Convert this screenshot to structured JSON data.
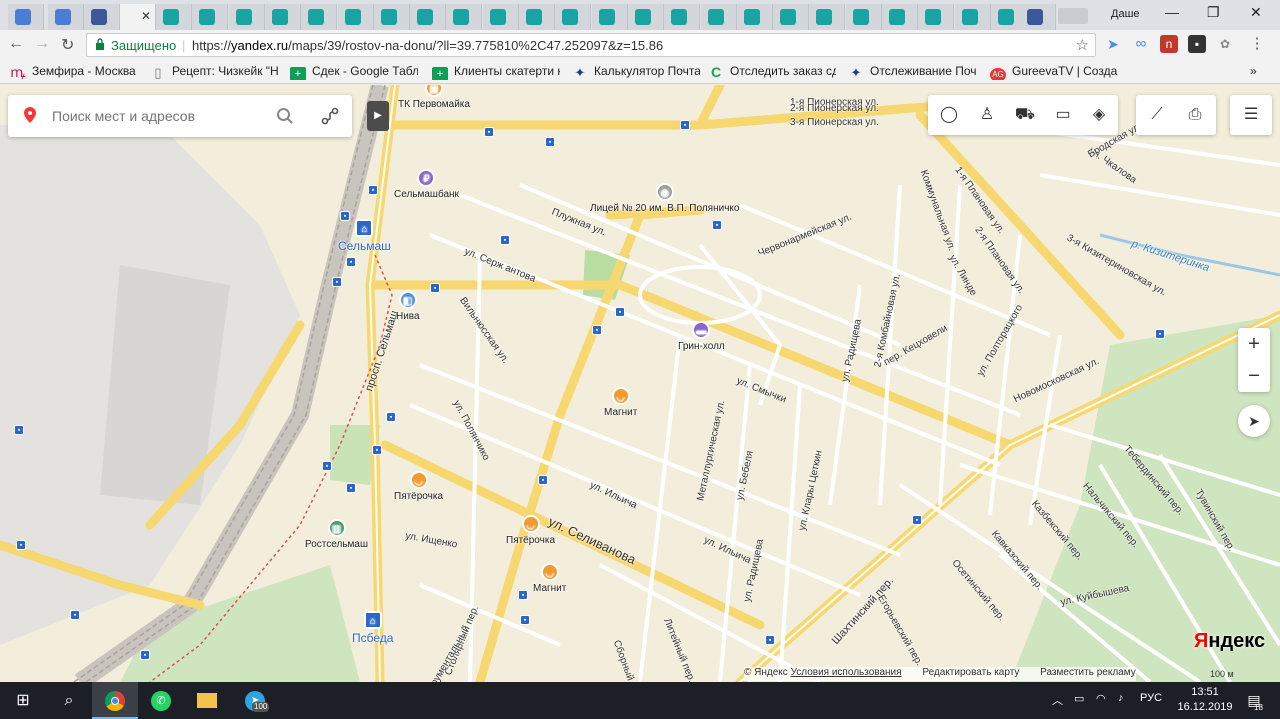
{
  "browser": {
    "profile_name": "Даше",
    "window_controls": {
      "minimize": "—",
      "maximize": "❐",
      "close": "✕"
    },
    "tabs_active_close": "✕",
    "secure_label": "Защищено",
    "url_scheme": "https://",
    "url_host": "yandex.ru",
    "url_path": "/maps/39/rostov-na-donu/?ll=39.775810%2C47.252097&z=15.86"
  },
  "bookmarks": [
    {
      "label": "Земфира - Москва",
      "icon": "music-icon",
      "color": "#c2185b"
    },
    {
      "label": "Рецепт: Чизкейк \"Н",
      "icon": "page-icon",
      "color": "#777777"
    },
    {
      "label": "Сдек - Google Табл",
      "icon": "sheets-icon",
      "color": "#0f9d58"
    },
    {
      "label": "Клиенты скатерти н",
      "icon": "sheets-icon",
      "color": "#0f9d58"
    },
    {
      "label": "Калькулятор Почта",
      "icon": "russian-post-icon",
      "color": "#1a3d8f"
    },
    {
      "label": "Отследить заказ сд",
      "icon": "cdek-icon",
      "color": "#1aa34a"
    },
    {
      "label": "Отслеживание  Поч",
      "icon": "russian-post-icon",
      "color": "#1a3d8f"
    },
    {
      "label": "GureevaTV | Создай",
      "icon": "gureeva-icon",
      "color": "#e53935"
    }
  ],
  "bookmarks_overflow": "»",
  "search": {
    "placeholder": "Поиск мест и адресов"
  },
  "map_tools": [
    "traffic-icon",
    "panorama-icon",
    "carsharing-icon",
    "transport-icon",
    "layers-icon",
    "ruler-icon",
    "print-icon",
    "menu-icon"
  ],
  "zoom": {
    "in": "+",
    "out": "−"
  },
  "streets": [
    "1-я Пионерская ул.",
    "2-я Пионерская ул.",
    "3-я Пионерская ул.",
    "Плужная ул.",
    "ул. Серж антова",
    "Вильнюсская ул.",
    "просп. Сельмаш",
    "ул. Смычки",
    "Червонармейская ул.",
    "Коммунальная ул.",
    "1-я Плановая ул.",
    "2-я Плановая ул.",
    "ул. Линде",
    "ул. Радищева",
    "2-я Комбайновая ул.",
    "пер. Кецховели",
    "ул. Полторацкого",
    "Новомосковская ул.",
    "ул. Чкалова",
    "Бродская ул.",
    "3-я Кизитериновская ул.",
    "ул. Полянчико",
    "Металлургическая ул.",
    "ул. Бебеля",
    "ул. Клары Цеткин",
    "ул. Ильича",
    "ул. Ильича",
    "ул. Радищева",
    "ул. Селиванова",
    "ул. Ищенко",
    "Шахтинский пер.",
    "Егорьевский пер.",
    "Казбекский пер.",
    "Кавказский пер.",
    "Осетинский пер.",
    "ул. Куйбышева",
    "Нальчикский пер.",
    "Тебердинский пер.",
    "Тувинский пер.",
    "Столярный пер.",
    "Литейный пер.",
    "Сборный",
    "Инструментальный"
  ],
  "river": "р. Кизитеринка",
  "pois": [
    {
      "label": "ТК Первомайка",
      "icon": "mall-icon",
      "color": "#f29a2e"
    },
    {
      "label": "Сельмашбанк",
      "icon": "bank-icon",
      "color": "#8a66c9"
    },
    {
      "label": "Лицей № 20 им. В.П. Поляничко",
      "icon": "school-icon",
      "color": "#9e9e9e"
    },
    {
      "label": "Сельмаш",
      "icon": "train-station-icon",
      "color": "#2a67c9"
    },
    {
      "label": "Нива",
      "icon": "shop-bag-icon",
      "color": "#4a90d9"
    },
    {
      "label": "Грин-холл",
      "icon": "hotel-icon",
      "color": "#8a66c9"
    },
    {
      "label": "Магнит",
      "icon": "shop-basket-icon",
      "color": "#f29a2e"
    },
    {
      "label": "Пятёрочка",
      "icon": "shop-basket-icon",
      "color": "#f29a2e"
    },
    {
      "label": "Ростсельмаш",
      "icon": "museum-icon",
      "color": "#4a9a6a"
    },
    {
      "label": "Пятёрочка",
      "icon": "shop-basket-icon",
      "color": "#f29a2e"
    },
    {
      "label": "Магнит",
      "icon": "shop-basket-icon",
      "color": "#f29a2e"
    },
    {
      "label": "Псбеда",
      "icon": "train-station-icon",
      "color": "#2a67c9"
    }
  ],
  "logo": {
    "first": "Я",
    "rest": "ндекс"
  },
  "footer": {
    "copyright": "© Яндекс",
    "terms": "Условия использования",
    "edit": "Редактировать карту",
    "ads": "Разместить рекламу"
  },
  "scale_label": "100 м",
  "taskbar": {
    "lang": "РУС",
    "time": "13:51",
    "date": "16.12.2019",
    "notifications": "18",
    "telegram_badge": "100"
  }
}
